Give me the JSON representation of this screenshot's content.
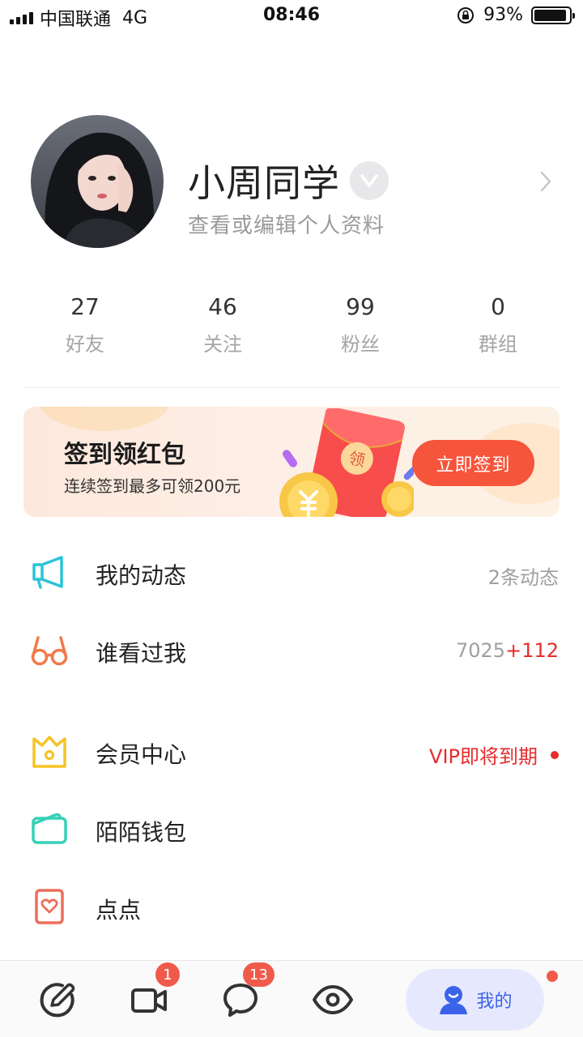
{
  "status_bar": {
    "carrier": "中国联通",
    "network": "4G",
    "time": "08:46",
    "battery_text": "93%",
    "battery_level": 0.93
  },
  "profile": {
    "name": "小周同学",
    "subtitle": "查看或编辑个人资料"
  },
  "stats": [
    {
      "value": "27",
      "label": "好友"
    },
    {
      "value": "46",
      "label": "关注"
    },
    {
      "value": "99",
      "label": "粉丝"
    },
    {
      "value": "0",
      "label": "群组"
    }
  ],
  "banner": {
    "title": "签到领红包",
    "subtitle": "连续签到最多可领200元",
    "envelope_text": "领",
    "button": "立即签到"
  },
  "menu": {
    "moments": {
      "label": "我的动态",
      "right": "2条动态"
    },
    "visitors": {
      "label": "谁看过我",
      "count": "7025",
      "increment": "+112"
    },
    "vip": {
      "label": "会员中心",
      "right": "VIP即将到期"
    },
    "wallet": {
      "label": "陌陌钱包"
    },
    "dots": {
      "label": "点点"
    }
  },
  "tab_bar": {
    "video_badge": "1",
    "chat_badge": "13",
    "me_label": "我的"
  },
  "colors": {
    "accent_blue": "#3b63ea",
    "accent_red": "#e72c2c",
    "button_orange": "#f6543b",
    "moments_icon": "#2cc3d8",
    "visitors_icon": "#f07a4a",
    "vip_icon": "#f5c326",
    "wallet_icon": "#36d1b6",
    "dots_icon": "#ec6e5a"
  },
  "icons": {
    "moments": "megaphone-icon",
    "visitors": "glasses-icon",
    "vip": "crown-icon",
    "wallet": "wallet-icon",
    "dots": "heart-card-icon",
    "tab_post": "compose-icon",
    "tab_video": "video-camera-icon",
    "tab_chat": "chat-bubble-icon",
    "tab_discover": "eye-icon",
    "tab_me": "user-icon"
  }
}
